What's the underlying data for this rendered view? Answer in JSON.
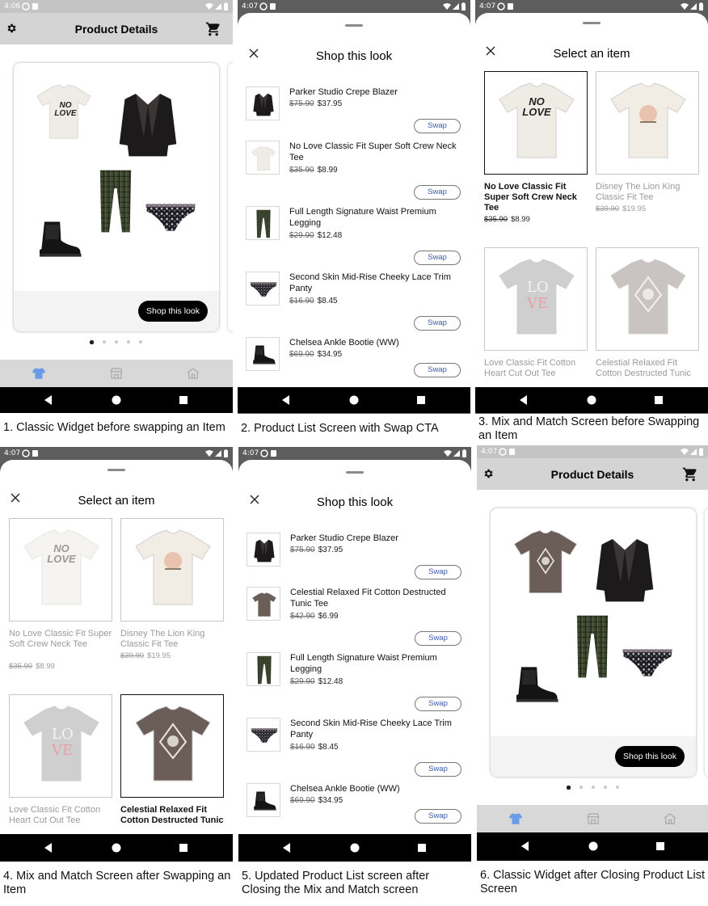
{
  "panels": [
    {
      "time": "4:06",
      "title": "Product Details",
      "shop_button": "Shop this look",
      "caption": "1. Classic Widget before swapping an Item"
    },
    {
      "time": "4:07",
      "title": "Shop this look",
      "swap_label": "Swap",
      "items": [
        {
          "name": "Parker Studio Crepe Blazer",
          "old_price": "$75.90",
          "price": "$37.95"
        },
        {
          "name": "No Love Classic Fit Super Soft Crew Neck Tee",
          "old_price": "$35.90",
          "price": "$8.99"
        },
        {
          "name": "Full Length Signature Waist Premium Legging",
          "old_price": "$29.90",
          "price": "$12.48"
        },
        {
          "name": "Second Skin Mid-Rise Cheeky Lace Trim Panty",
          "old_price": "$16.90",
          "price": "$8.45"
        },
        {
          "name": "Chelsea Ankle Bootie (WW)",
          "old_price": "$69.90",
          "price": "$34.95"
        }
      ],
      "caption": "2. Product List Screen with Swap CTA"
    },
    {
      "time": "4:07",
      "title": "Select an item",
      "grid": [
        {
          "name": "No Love Classic Fit Super Soft Crew Neck Tee",
          "old_price": "$35.90",
          "price": "$8.99"
        },
        {
          "name": "Disney The Lion King Classic Fit Tee",
          "old_price": "$39.90",
          "price": "$19.95"
        },
        {
          "name": "Love Classic Fit Cotton Heart Cut Out Tee",
          "old_price": "",
          "price": ""
        },
        {
          "name": "Celestial Relaxed Fit Cotton Destructed Tunic",
          "old_price": "",
          "price": ""
        }
      ],
      "caption": "3. Mix and Match Screen before Swapping an Item"
    },
    {
      "time": "4:07",
      "title": "Select an item",
      "grid": [
        {
          "name": "No Love Classic Fit Super Soft Crew Neck Tee",
          "old_price": "$35.90",
          "price": "$8.99"
        },
        {
          "name": "Disney The Lion King Classic Fit Tee",
          "old_price": "$39.90",
          "price": "$19.95"
        },
        {
          "name": "Love Classic Fit Cotton Heart Cut Out Tee",
          "old_price": "",
          "price": ""
        },
        {
          "name": "Celestial Relaxed Fit Cotton Destructed Tunic",
          "old_price": "",
          "price": ""
        }
      ],
      "caption": "4. Mix and Match Screen after Swapping an Item"
    },
    {
      "time": "4:07",
      "title": "Shop this look",
      "swap_label": "Swap",
      "items": [
        {
          "name": "Parker Studio Crepe Blazer",
          "old_price": "$75.90",
          "price": "$37.95"
        },
        {
          "name": "Celestial Relaxed Fit Cotton Destructed Tunic Tee",
          "old_price": "$42.90",
          "price": "$6.99"
        },
        {
          "name": "Full Length Signature Waist Premium Legging",
          "old_price": "$29.90",
          "price": "$12.48"
        },
        {
          "name": "Second Skin Mid-Rise Cheeky Lace Trim Panty",
          "old_price": "$16.90",
          "price": "$8.45"
        },
        {
          "name": "Chelsea Ankle Bootie (WW)",
          "old_price": "$69.90",
          "price": "$34.95"
        }
      ],
      "caption": "5. Updated Product List screen after Closing the Mix and Match screen"
    },
    {
      "time": "4:07",
      "title": "Product Details",
      "shop_button": "Shop this look",
      "caption": "6. Classic Widget after Closing Product List Screen"
    }
  ],
  "tee_print": "NO LOVE",
  "icons": [
    "gear-icon",
    "cart-icon",
    "close-icon",
    "shirt-icon",
    "store-icon",
    "home-icon",
    "back-icon",
    "home-circle-icon",
    "recents-icon",
    "wifi-icon",
    "signal-icon",
    "battery-icon"
  ],
  "colors": {
    "accent": "#3b5ba8",
    "nav_active": "#6a9be8",
    "appbar": "#d4d4d4",
    "status_dark": "#5d5d5d"
  }
}
